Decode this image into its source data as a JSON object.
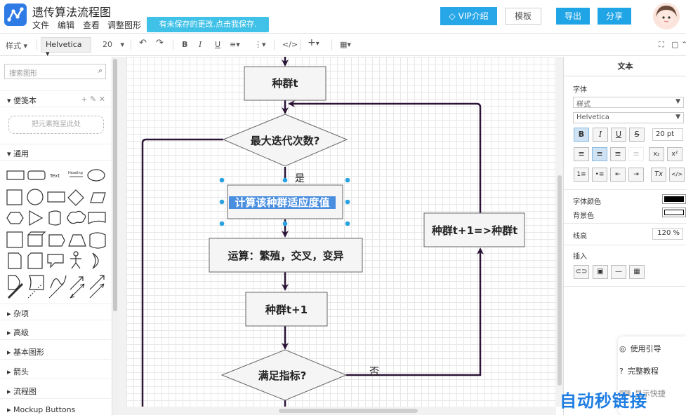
{
  "header": {
    "title": "遗传算法流程图",
    "menu": [
      "文件",
      "编辑",
      "查看",
      "调整图形"
    ],
    "unsaved_notice": "有未保存的更改.点击我保存.",
    "vip_label": "VIP介绍",
    "template_label": "模板",
    "export_label": "导出",
    "share_label": "分享"
  },
  "toolbar": {
    "style_label": "样式",
    "font": "Helvetica",
    "font_size": "20"
  },
  "sidebar": {
    "search_placeholder": "搜索图形",
    "scratchpad_label": "便笺本",
    "dropzone_text": "把元素拖至此处",
    "general_label": "通用",
    "shape_text_label": "Text",
    "shape_heading_label": "Heading",
    "sections": [
      "杂项",
      "高级",
      "基本图形",
      "箭头",
      "流程图",
      "Mockup Buttons"
    ]
  },
  "diagram": {
    "node_population_t": "种群t",
    "node_max_iter": "最大迭代次数?",
    "label_yes": "是",
    "node_fitness": "计算该种群适应度值",
    "node_ops": "运算：繁殖，交叉，变异",
    "node_population_t1": "种群t+1",
    "node_meets": "满足指标?",
    "label_no": "否",
    "node_update": "种群t+1=>种群t"
  },
  "right_panel": {
    "tab_text": "文本",
    "font_label": "字体",
    "style_value": "样式",
    "font_value": "Helvetica",
    "font_size_value": "20 pt",
    "font_color_label": "字体颜色",
    "bg_color_label": "背景色",
    "line_height_label": "线高",
    "line_height_value": "120 %",
    "insert_label": "插入",
    "help_guide": "使用引导",
    "help_tutorial": "完整教程",
    "help_more": "显示快捷"
  },
  "colors": {
    "accent": "#1fa4e6",
    "arrow": "#2b1436",
    "node_fill": "#f5f5f5",
    "selection": "#29a3e0"
  },
  "watermark": "自动秒链接"
}
